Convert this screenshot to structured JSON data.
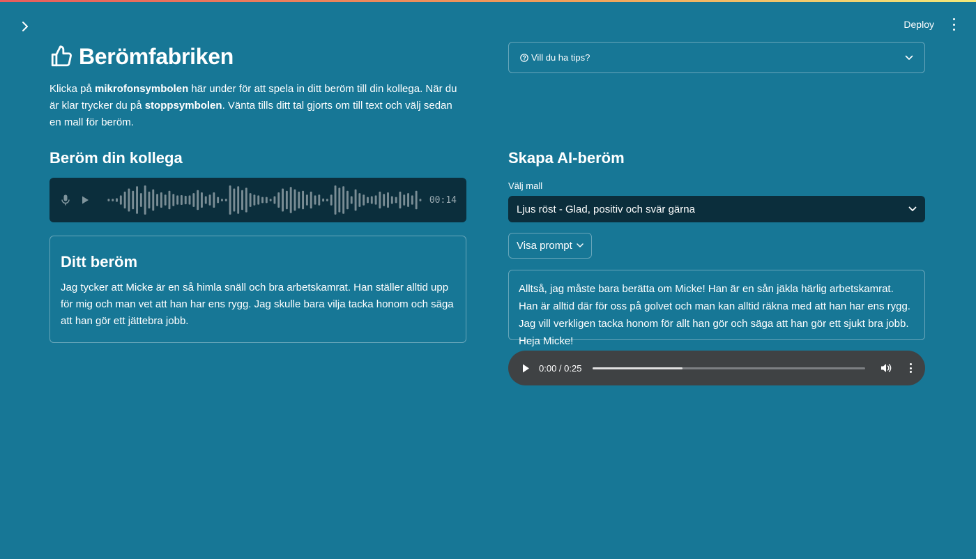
{
  "topbar": {
    "deploy_label": "Deploy"
  },
  "header": {
    "title": "Berömfabriken",
    "intro": {
      "p1": "Klicka på ",
      "b1": "mikrofonsymbolen",
      "p2": " här under för att spela in ditt beröm till din kollega. När du är klar trycker du på ",
      "b2": "stoppsymbolen",
      "p3": ". Vänta tills ditt tal gjorts om till text och välj sedan en mall för beröm."
    }
  },
  "left": {
    "section_title": "Beröm din kollega",
    "recorder": {
      "time": "00:14",
      "levels": [
        0.08,
        0.08,
        0.12,
        0.3,
        0.55,
        0.75,
        0.6,
        0.9,
        0.45,
        0.95,
        0.55,
        0.7,
        0.4,
        0.5,
        0.35,
        0.6,
        0.4,
        0.3,
        0.32,
        0.28,
        0.3,
        0.45,
        0.65,
        0.5,
        0.25,
        0.35,
        0.5,
        0.2,
        0.08,
        0.08,
        0.95,
        0.75,
        0.9,
        0.65,
        0.8,
        0.45,
        0.35,
        0.3,
        0.2,
        0.2,
        0.08,
        0.25,
        0.5,
        0.75,
        0.6,
        0.85,
        0.7,
        0.55,
        0.6,
        0.35,
        0.55,
        0.3,
        0.35,
        0.1,
        0.08,
        0.35,
        0.95,
        0.8,
        0.9,
        0.6,
        0.25,
        0.7,
        0.45,
        0.35,
        0.2,
        0.25,
        0.3,
        0.55,
        0.4,
        0.5,
        0.25,
        0.2,
        0.55,
        0.35,
        0.45,
        0.3,
        0.6,
        0.08
      ]
    },
    "praise_card": {
      "title": "Ditt beröm",
      "text": "Jag tycker att Micke är en så himla snäll och bra arbetskamrat. Han ställer alltid upp för mig och man vet att han har ens rygg. Jag skulle bara vilja tacka honom och säga att han gör ett jättebra jobb."
    }
  },
  "right": {
    "expander_label": "Vill du ha tips?",
    "section_title": "Skapa AI-beröm",
    "select_label": "Välj mall",
    "select_value": "Ljus röst - Glad, positiv och svär gärna",
    "prompt_button": "Visa prompt",
    "ai_text": "Alltså, jag måste bara berätta om Micke! Han är en sån jäkla härlig arbetskamrat. Han är alltid där för oss på golvet och man kan alltid räkna med att han har ens rygg. Jag vill verkligen tacka honom för allt han gör och säga att han gör ett sjukt bra jobb. Heja Micke!",
    "audio": {
      "time": "0:00 / 0:25",
      "progress": 0.33
    }
  },
  "icons": {
    "sidebar_toggle": "chevron-right-icon",
    "title": "thumbs-up-icon",
    "mic": "microphone-icon",
    "play": "play-icon",
    "help": "question-circle-icon",
    "expand": "chevron-down-icon",
    "volume": "volume-icon",
    "menu": "kebab-menu-icon"
  },
  "colors": {
    "background": "#177796",
    "dark_field": "#0b2e3c",
    "audio_player": "#3f4244"
  }
}
